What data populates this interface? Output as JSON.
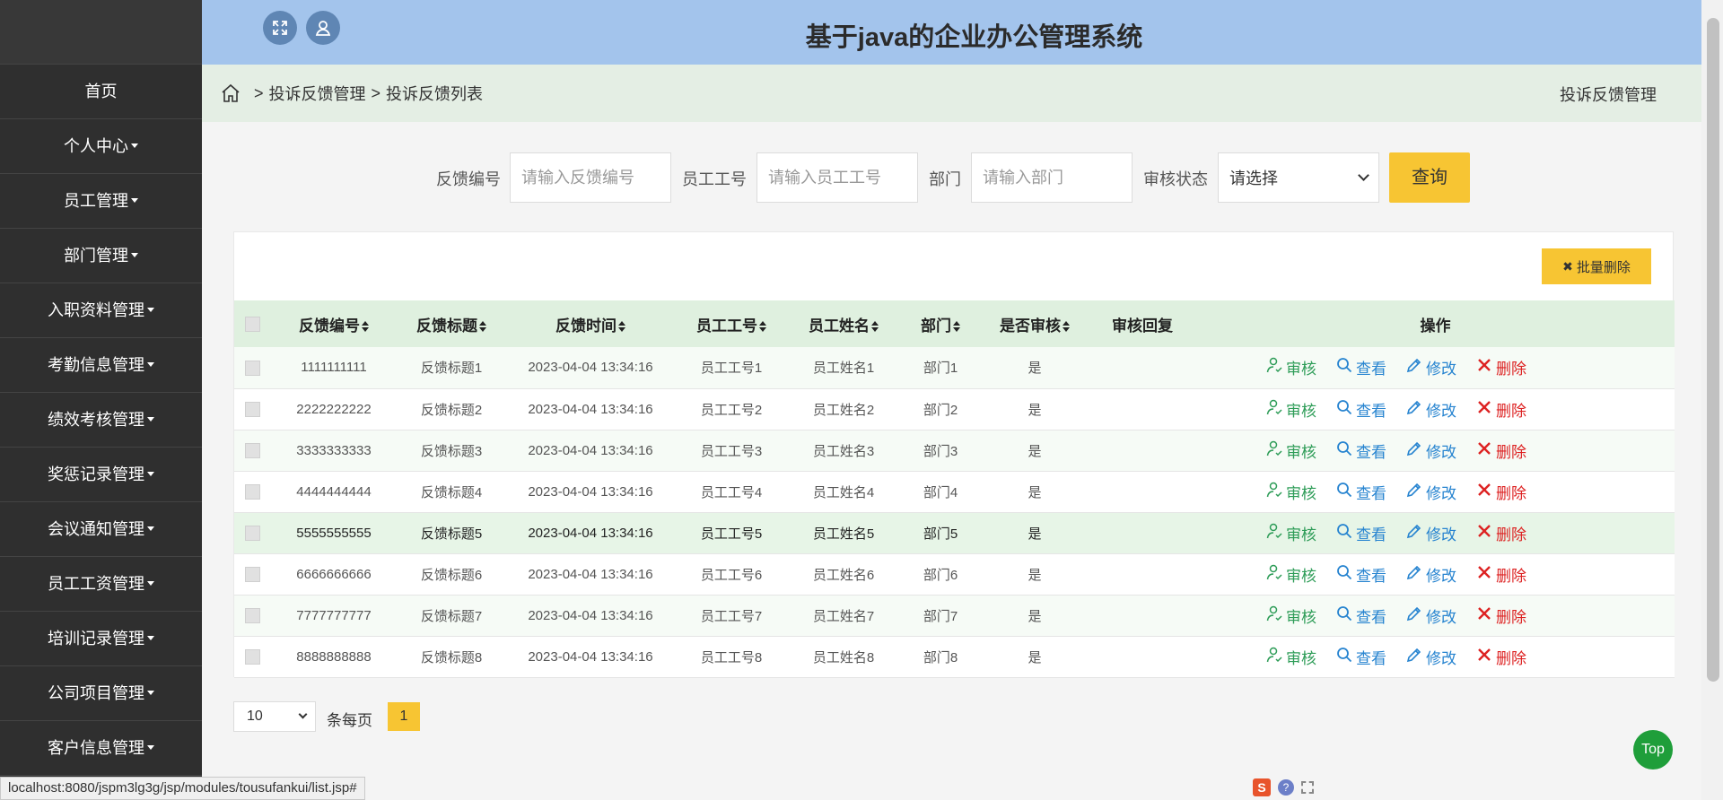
{
  "header": {
    "title": "基于java的企业办公管理系统"
  },
  "sidebar": {
    "items": [
      {
        "label": "首页",
        "dropdown": false
      },
      {
        "label": "个人中心",
        "dropdown": true
      },
      {
        "label": "员工管理",
        "dropdown": true
      },
      {
        "label": "部门管理",
        "dropdown": true
      },
      {
        "label": "入职资料管理",
        "dropdown": true
      },
      {
        "label": "考勤信息管理",
        "dropdown": true
      },
      {
        "label": "绩效考核管理",
        "dropdown": true
      },
      {
        "label": "奖惩记录管理",
        "dropdown": true
      },
      {
        "label": "会议通知管理",
        "dropdown": true
      },
      {
        "label": "员工工资管理",
        "dropdown": true
      },
      {
        "label": "培训记录管理",
        "dropdown": true
      },
      {
        "label": "公司项目管理",
        "dropdown": true
      },
      {
        "label": "客户信息管理",
        "dropdown": true
      }
    ]
  },
  "breadcrumb": {
    "sep": ">",
    "level1": "投诉反馈管理",
    "level2": "投诉反馈列表",
    "right": "投诉反馈管理"
  },
  "search": {
    "feedback_no_label": "反馈编号",
    "feedback_no_placeholder": "请输入反馈编号",
    "emp_no_label": "员工工号",
    "emp_no_placeholder": "请输入员工工号",
    "dept_label": "部门",
    "dept_placeholder": "请输入部门",
    "status_label": "审核状态",
    "status_value": "请选择",
    "query_label": "查询"
  },
  "toolbar": {
    "batch_delete": "批量删除"
  },
  "table": {
    "headers": [
      "反馈编号",
      "反馈标题",
      "反馈时间",
      "员工工号",
      "员工姓名",
      "部门",
      "是否审核",
      "审核回复",
      "操作"
    ],
    "actions": {
      "audit": "审核",
      "view": "查看",
      "edit": "修改",
      "delete": "删除"
    },
    "rows": [
      [
        "1111111111",
        "反馈标题1",
        "2023-04-04 13:34:16",
        "员工工号1",
        "员工姓名1",
        "部门1",
        "是",
        ""
      ],
      [
        "2222222222",
        "反馈标题2",
        "2023-04-04 13:34:16",
        "员工工号2",
        "员工姓名2",
        "部门2",
        "是",
        ""
      ],
      [
        "3333333333",
        "反馈标题3",
        "2023-04-04 13:34:16",
        "员工工号3",
        "员工姓名3",
        "部门3",
        "是",
        ""
      ],
      [
        "4444444444",
        "反馈标题4",
        "2023-04-04 13:34:16",
        "员工工号4",
        "员工姓名4",
        "部门4",
        "是",
        ""
      ],
      [
        "5555555555",
        "反馈标题5",
        "2023-04-04 13:34:16",
        "员工工号5",
        "员工姓名5",
        "部门5",
        "是",
        ""
      ],
      [
        "6666666666",
        "反馈标题6",
        "2023-04-04 13:34:16",
        "员工工号6",
        "员工姓名6",
        "部门6",
        "是",
        ""
      ],
      [
        "7777777777",
        "反馈标题7",
        "2023-04-04 13:34:16",
        "员工工号7",
        "员工姓名7",
        "部门7",
        "是",
        ""
      ],
      [
        "8888888888",
        "反馈标题8",
        "2023-04-04 13:34:16",
        "员工工号8",
        "员工姓名8",
        "部门8",
        "是",
        ""
      ]
    ]
  },
  "pagination": {
    "page_size": "10",
    "per_page_label": "条每页",
    "current_page": "1"
  },
  "top_button": "Top",
  "status_bar": {
    "url": "localhost:8080/jspm3lg3g/jsp/modules/tousufankui/list.jsp#"
  },
  "colors": {
    "accent": "#f7c533",
    "header_bg": "#a3c4ec",
    "sidebar_bg": "#2f2f2f"
  }
}
